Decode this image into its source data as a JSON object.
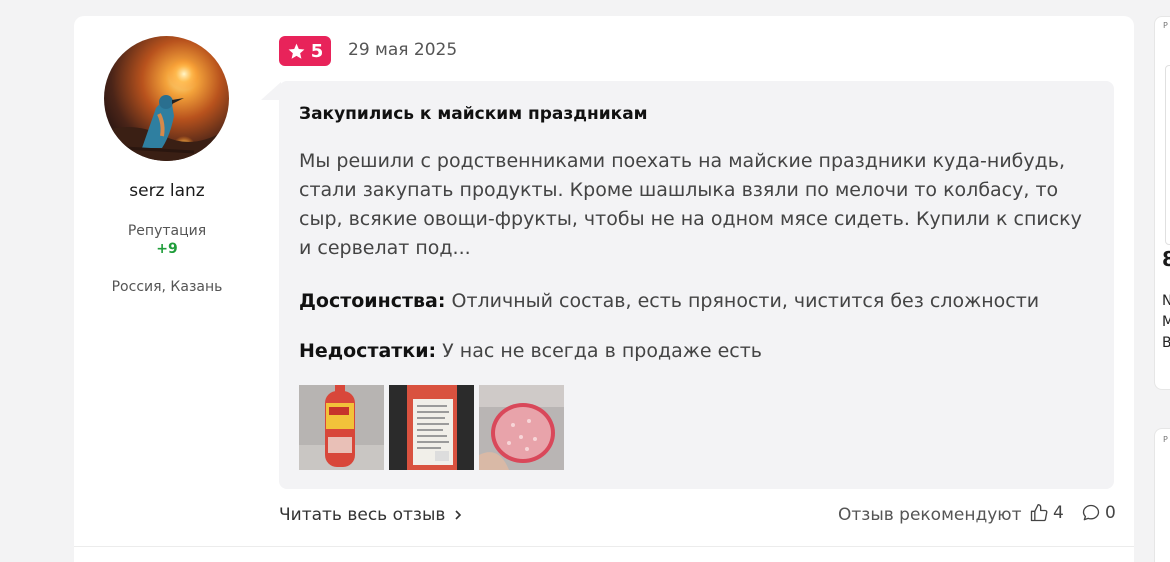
{
  "author": {
    "name": "serz lanz",
    "reputation_label": "Репутация",
    "reputation_value": "+9",
    "location": "Россия, Казань"
  },
  "review": {
    "rating": "5",
    "date": "29 мая 2025",
    "title": "Закупились к майским праздникам",
    "body": "Мы решили с родственниками поехать на майские праздники куда-нибудь, стали закупать продукты. Кроме шашлыка взяли по мелочи то колбасу, то сыр, всякие овощи-фрукты, чтобы не на одном мясе сидеть. Купили к списку и сервелат под...",
    "pros_label": "Достоинства:",
    "pros_text": " Отличный состав, есть пряности, чистится без сложности",
    "cons_label": "Недостатки:",
    "cons_text": " У нас не всегда в продаже есть"
  },
  "footer": {
    "read_more": "Читать весь отзыв",
    "recommend_label": "Отзыв рекомендуют",
    "likes_count": "4",
    "comments_count": "0"
  },
  "side": {
    "p1": "P",
    "big": "8",
    "lines": [
      "N",
      "M",
      "B"
    ],
    "p2": "P"
  },
  "colors": {
    "accent": "#e8235a",
    "reputation": "#1f9d3a",
    "bubble": "#f3f3f5"
  },
  "icons": [
    "star-icon",
    "chevron-right-icon",
    "thumbs-up-icon",
    "comment-icon"
  ]
}
